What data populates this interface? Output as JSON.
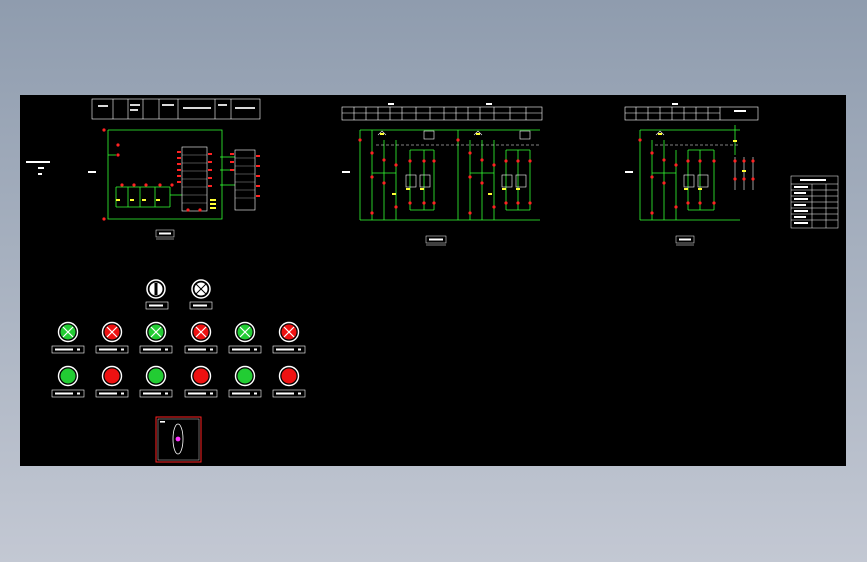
{
  "drawing": {
    "background": "#000000",
    "colors": {
      "wire": "#33ff33",
      "device": "#ff2222",
      "terminal": "#ffff33",
      "frame": "#ffffff",
      "accent": "#ff33ff"
    },
    "panels": [
      {
        "caption": "",
        "label_left": "",
        "label_side": ""
      },
      {
        "caption": "",
        "label_side": ""
      },
      {
        "caption": "",
        "label_side": ""
      }
    ],
    "legend_table_title": "",
    "indicator_lamps": {
      "selector_switch_count": 1,
      "lamp_rows": [
        [
          "green",
          "red",
          "green",
          "red",
          "green",
          "red"
        ],
        [
          "green",
          "red",
          "green",
          "red",
          "green",
          "red"
        ]
      ]
    }
  }
}
